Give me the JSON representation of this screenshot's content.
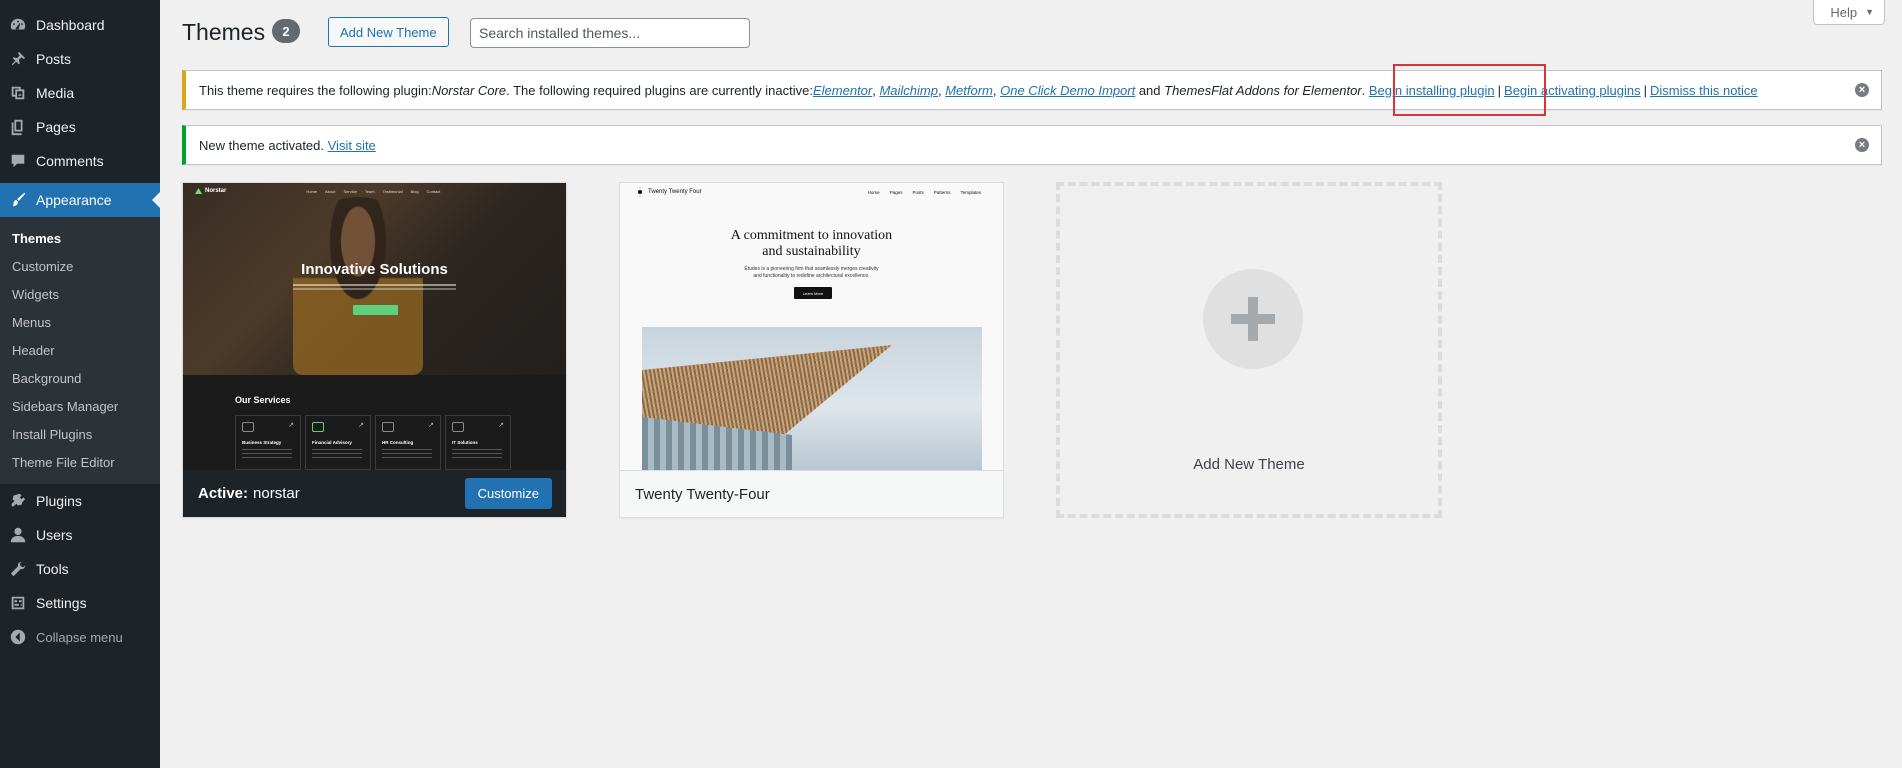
{
  "sidebar": {
    "top_items": [
      {
        "label": "Dashboard",
        "icon": "dashboard-icon"
      },
      {
        "label": "Posts",
        "icon": "pin-icon"
      },
      {
        "label": "Media",
        "icon": "media-icon"
      },
      {
        "label": "Pages",
        "icon": "pages-icon"
      },
      {
        "label": "Comments",
        "icon": "comment-icon"
      }
    ],
    "appearance": {
      "label": "Appearance",
      "icon": "paintbrush-icon"
    },
    "submenu": [
      "Themes",
      "Customize",
      "Widgets",
      "Menus",
      "Header",
      "Background",
      "Sidebars Manager",
      "Install Plugins",
      "Theme File Editor"
    ],
    "bottom_items": [
      {
        "label": "Plugins",
        "icon": "plug-icon"
      },
      {
        "label": "Users",
        "icon": "user-icon"
      },
      {
        "label": "Tools",
        "icon": "wrench-icon"
      },
      {
        "label": "Settings",
        "icon": "settings-icon"
      }
    ],
    "collapse_label": "Collapse menu"
  },
  "header": {
    "title": "Themes",
    "count": "2",
    "add_new_label": "Add New Theme",
    "search_placeholder": "Search installed themes...",
    "help_label": "Help"
  },
  "notices": {
    "plugin": {
      "text_1": "This theme requires the following plugin: ",
      "required_plugin": "Norstar Core",
      "text_2": ". The following required plugins are currently inactive: ",
      "links": [
        "Elementor",
        "Mailchimp",
        "Metform",
        "One Click Demo Import"
      ],
      "and": " and ",
      "last_plugin": "ThemesFlat Addons for Elementor",
      "period": ". ",
      "begin_installing": "Begin installing plugin",
      "begin_activating": "Begin activating plugins",
      "dismiss": "Dismiss this notice",
      "separator": "|"
    },
    "activated": {
      "text": "New theme activated. ",
      "link": "Visit site"
    }
  },
  "themes": {
    "active": {
      "active_prefix": "Active:",
      "name": "norstar",
      "customize_label": "Customize",
      "preview": {
        "logo": "Norstar",
        "nav": [
          "Home",
          "About",
          "Service",
          "Team",
          "Testimonial",
          "Blog",
          "Contact"
        ],
        "hero_title": "Innovative Solutions",
        "services_title": "Our Services",
        "services": [
          "Business Strategy",
          "Financial Advisory",
          "HR Consulting",
          "IT Solutions"
        ]
      }
    },
    "second": {
      "name": "Twenty Twenty-Four",
      "preview": {
        "site_title": "Twenty Twenty Four",
        "nav": [
          "Home",
          "Pages",
          "Posts",
          "Patterns",
          "Templates"
        ],
        "heading_1": "A commitment to innovation",
        "heading_2": "and sustainability",
        "sub_1": "Études is a pioneering firm that seamlessly merges creativity",
        "sub_2": "and functionality to redefine architectural excellence.",
        "button": "Learn More"
      }
    },
    "add_new_label": "Add New Theme"
  },
  "colors": {
    "accent": "#2271b1",
    "sidebar_bg": "#1d2327",
    "warning": "#dba617",
    "success": "#00a32a",
    "highlight": "#d63638"
  }
}
